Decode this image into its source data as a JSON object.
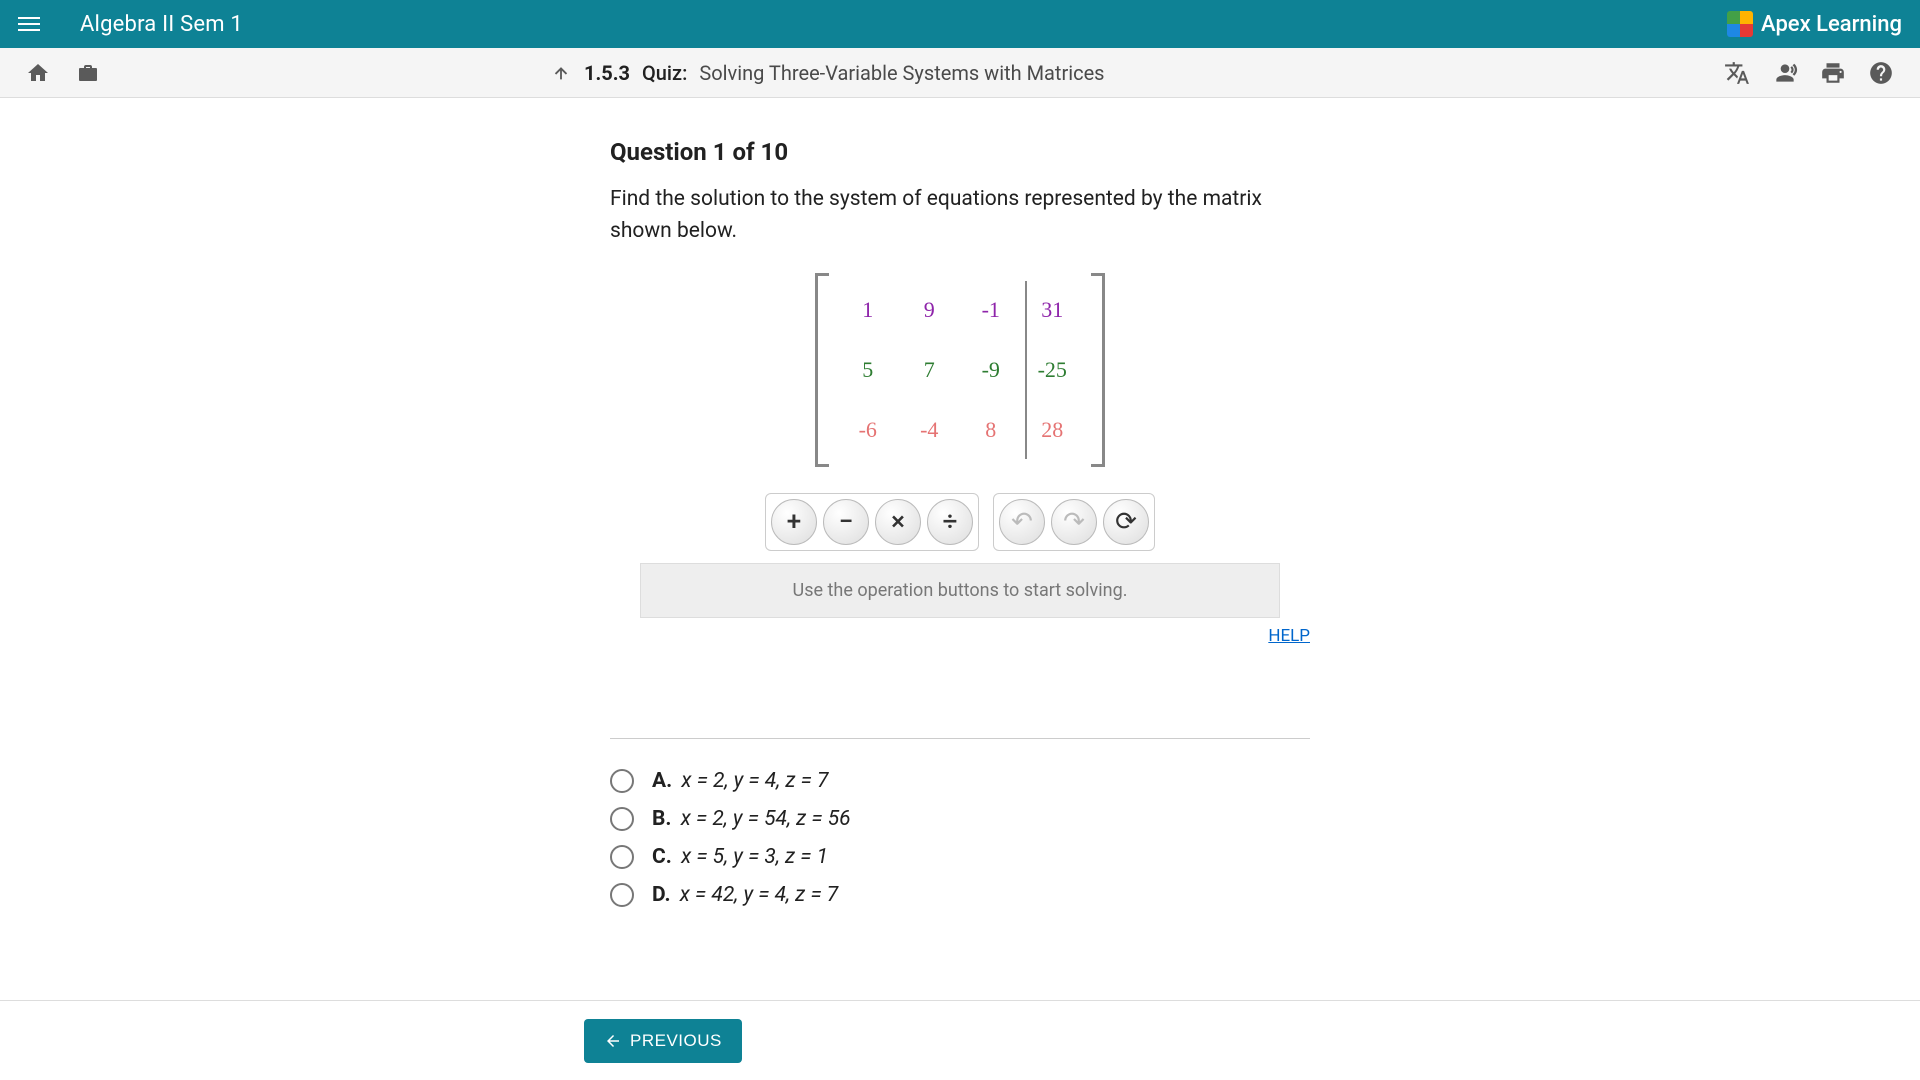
{
  "brand": {
    "name": "Apex Learning"
  },
  "course_title": "Algebra II Sem 1",
  "breadcrumb": {
    "code": "1.5.3",
    "type": "Quiz:",
    "title": "Solving Three-Variable Systems with Matrices"
  },
  "question": {
    "header": "Question 1 of 10",
    "text": "Find the solution to the system of equations represented by the matrix shown below."
  },
  "matrix": {
    "row1": [
      "1",
      "9",
      "-1",
      "31"
    ],
    "row2": [
      "5",
      "7",
      "-9",
      "-25"
    ],
    "row3": [
      "-6",
      "-4",
      "8",
      "28"
    ]
  },
  "ops": {
    "add": "+",
    "sub": "−",
    "mul": "×",
    "div": "÷",
    "undo": "↶",
    "redo": "↷",
    "reset": "⟳"
  },
  "hint": "Use the operation buttons to start solving.",
  "help_label": "HELP",
  "answers": [
    {
      "letter": "A.",
      "text": "x = 2, y = 4, z = 7"
    },
    {
      "letter": "B.",
      "text": "x = 2, y = 54, z = 56"
    },
    {
      "letter": "C.",
      "text": "x = 5, y = 3, z = 1"
    },
    {
      "letter": "D.",
      "text": "x = 42, y = 4, z = 7"
    }
  ],
  "prev_label": "PREVIOUS"
}
